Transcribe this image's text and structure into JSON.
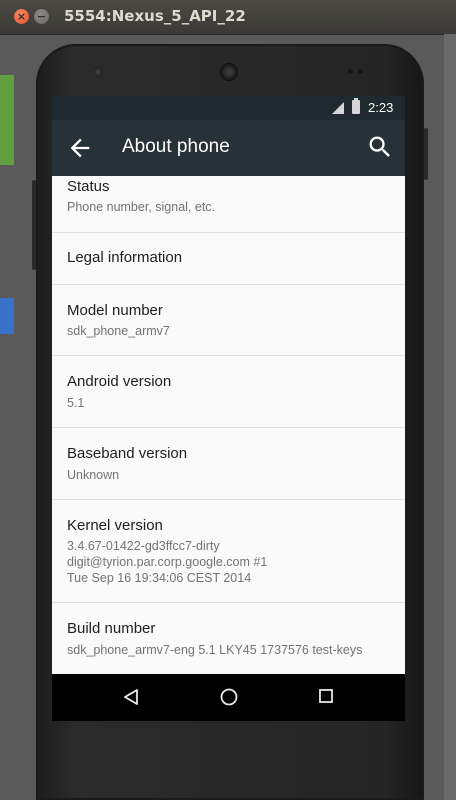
{
  "window": {
    "title": "5554:Nexus_5_API_22",
    "close_glyph": "×",
    "minimize_glyph": "−"
  },
  "statusbar": {
    "time": "2:23",
    "icons": [
      "signal-icon",
      "battery-icon"
    ]
  },
  "appbar": {
    "title": "About phone",
    "back_icon": "arrow-back-icon",
    "search_icon": "search-icon",
    "background": "#263238"
  },
  "settings_items": [
    {
      "title": "Status",
      "subtitle": "Phone number, signal, etc."
    },
    {
      "title": "Legal information",
      "subtitle": ""
    },
    {
      "title": "Model number",
      "subtitle": "sdk_phone_armv7"
    },
    {
      "title": "Android version",
      "subtitle": "5.1"
    },
    {
      "title": "Baseband version",
      "subtitle": "Unknown"
    },
    {
      "title": "Kernel version",
      "subtitle": "3.4.67-01422-gd3ffcc7-dirty\ndigit@tyrion.par.corp.google.com #1\nTue Sep 16 19:34:06 CEST 2014"
    },
    {
      "title": "Build number",
      "subtitle": "sdk_phone_armv7-eng 5.1 LKY45 1737576 test-keys"
    }
  ],
  "navbar": {
    "buttons": [
      "nav-back-icon",
      "nav-home-icon",
      "nav-recents-icon"
    ]
  }
}
